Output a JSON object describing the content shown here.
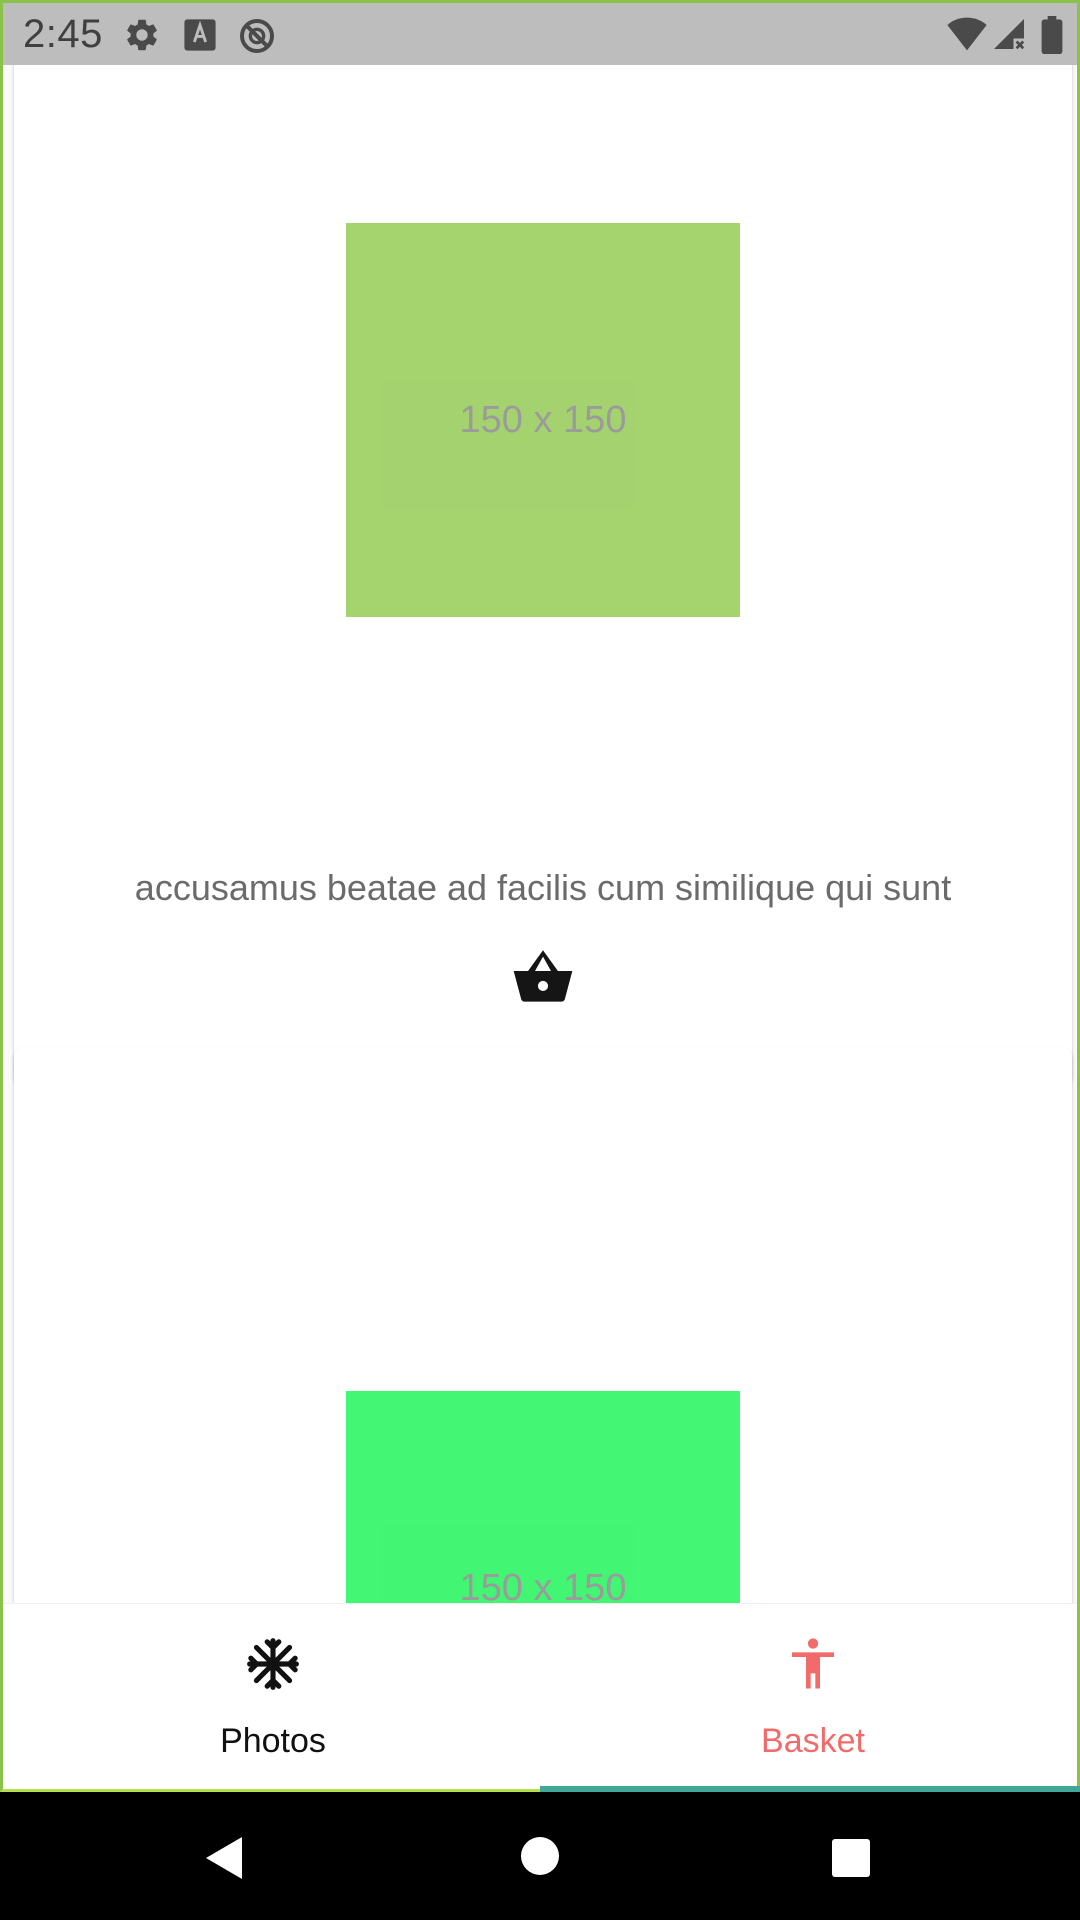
{
  "status_bar": {
    "time": "2:45",
    "icons": [
      "gear-icon",
      "text-a-icon",
      "no-sync-icon",
      "wifi-icon",
      "signal-icon",
      "battery-icon"
    ]
  },
  "cards": [
    {
      "image_text": "150 x 150",
      "image_color": "#95cb55",
      "caption": "accusamus beatae ad facilis cum similique qui sunt",
      "action_icon": "basket-icon"
    },
    {
      "image_text": "150 x 150",
      "image_color": "#22f55c"
    }
  ],
  "bottom_nav": {
    "items": [
      {
        "label": "Photos",
        "icon": "snowflake-icon",
        "active": false
      },
      {
        "label": "Basket",
        "icon": "accessibility-icon",
        "active": true,
        "color": "#f26b6b"
      }
    ],
    "indicator_color": "#43a798"
  },
  "system_nav": [
    "back-icon",
    "home-icon",
    "recents-icon"
  ]
}
